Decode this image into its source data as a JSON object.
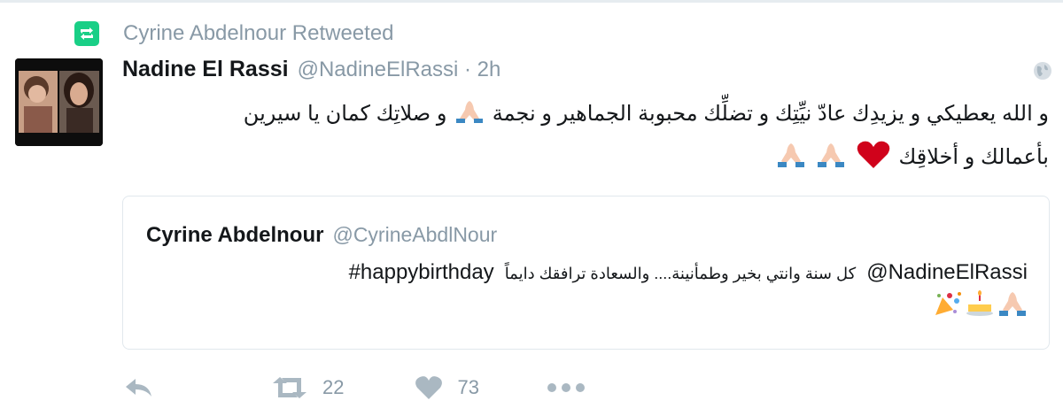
{
  "retweet_context": {
    "text": "Cyrine Abdelnour Retweeted",
    "icon": "retweet-icon"
  },
  "tweet": {
    "name": "Nadine El Rassi",
    "handle_time": "@NadineElRassi · 2h",
    "line1": "و صلاتِك كمان يا سيرين",
    "line1b": "و الله يعطيكي و يزيدِك عادّ نيِّتِك و تضلِّك محبوبة الجماهير و نجمة",
    "line2": "بأعمالك و أخلاقِك"
  },
  "quoted": {
    "name": "Cyrine Abdelnour",
    "handle": "@CyrineAbdlNour",
    "mention": "@NadineElRassi",
    "arabic": "كل سنة وانتي بخير  وطمأنينة....  والسعادة ترافقك دايماً",
    "hashtag": "#happybirthday"
  },
  "actions": {
    "reply_icon": "reply-icon",
    "retweet_icon": "retweet-icon",
    "retweet_count": "22",
    "like_icon": "heart-icon",
    "like_count": "73",
    "more_icon": "more-icon"
  },
  "colors": {
    "retweet_green": "#19cf86",
    "muted": "#8899a6",
    "text": "#14171a",
    "border": "#e1e8ed",
    "heart_red": "#d0021b"
  }
}
